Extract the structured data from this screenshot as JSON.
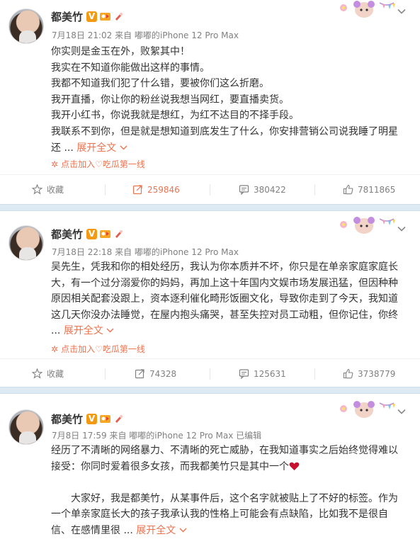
{
  "posts": [
    {
      "author": "都美竹",
      "verified_badge": "V",
      "meta": "7月18日 21:02 来自 嘟嘟的iPhone 12 Pro Max",
      "lines": [
        "你实则是金玉在外，败絮其中！",
        "我实在不知道你能做出这样的事情。",
        "我都不知道我们犯了什么错，要被你们这么折磨。",
        "我开直播，你让你的粉丝说我想当网红，要直播卖货。",
        "我开小红书，你说我就是想红，为红不达目的不择手段。",
        "我联系不到你，但是就是想知道到底发生了什么，你安排营销公司说我睡了明星"
      ],
      "last_line": "还 ...",
      "expand": "展开全文",
      "topic": "点击加入♡吃瓜第一线",
      "actions": {
        "fav": "收藏",
        "repost": "259846",
        "comment": "380422",
        "like": "7811865"
      }
    },
    {
      "author": "都美竹",
      "verified_badge": "V",
      "meta": "7月18日 22:18 来自 嘟嘟的iPhone 12 Pro Max",
      "lines": [
        "吴先生，凭我和你的相处经历，我认为你本质并不坏，你只是在单亲家庭家庭长",
        "大，有一个过分溺爱你的妈妈，再加上这十年国内文娱市场发展迅猛，但因种种",
        "原因相关配套没跟上，资本逐利催化畸形饭圈文化，导致你走到了今天，我知道",
        "这几天你没办法睡觉，在屋内抱头痛哭，甚至失控对员工动粗，但你记住，你终"
      ],
      "last_line": "...",
      "expand": "展开全文",
      "topic": "点击加入♡吃瓜第一线",
      "actions": {
        "fav": "收藏",
        "repost": "74328",
        "comment": "125631",
        "like": "3738779"
      }
    },
    {
      "author": "都美竹",
      "verified_badge": "V",
      "meta": "7月8日 17:59 来自 嘟嘟的iPhone 12 Pro Max  已编辑",
      "lines": [
        "经历了不清晰的网络暴力、不清晰的死亡威胁，在我知道事实之后始终觉得难以",
        "接受：你同时爱着很多女孩，而我都美竹只是其中一个"
      ],
      "para2": [
        "大家好，我是都美竹，从某事件后，这个名字就被贴上了不好的标签。作为",
        "一个单亲家庭长大的孩子我承认我的性格上可能会有点缺陷，比如我不是很自",
        "信、在感情里很 ..."
      ],
      "expand": "展开全文"
    }
  ],
  "colors": {
    "accent": "#eb7350",
    "separator": "#ddeaf3",
    "meta": "#808080"
  }
}
